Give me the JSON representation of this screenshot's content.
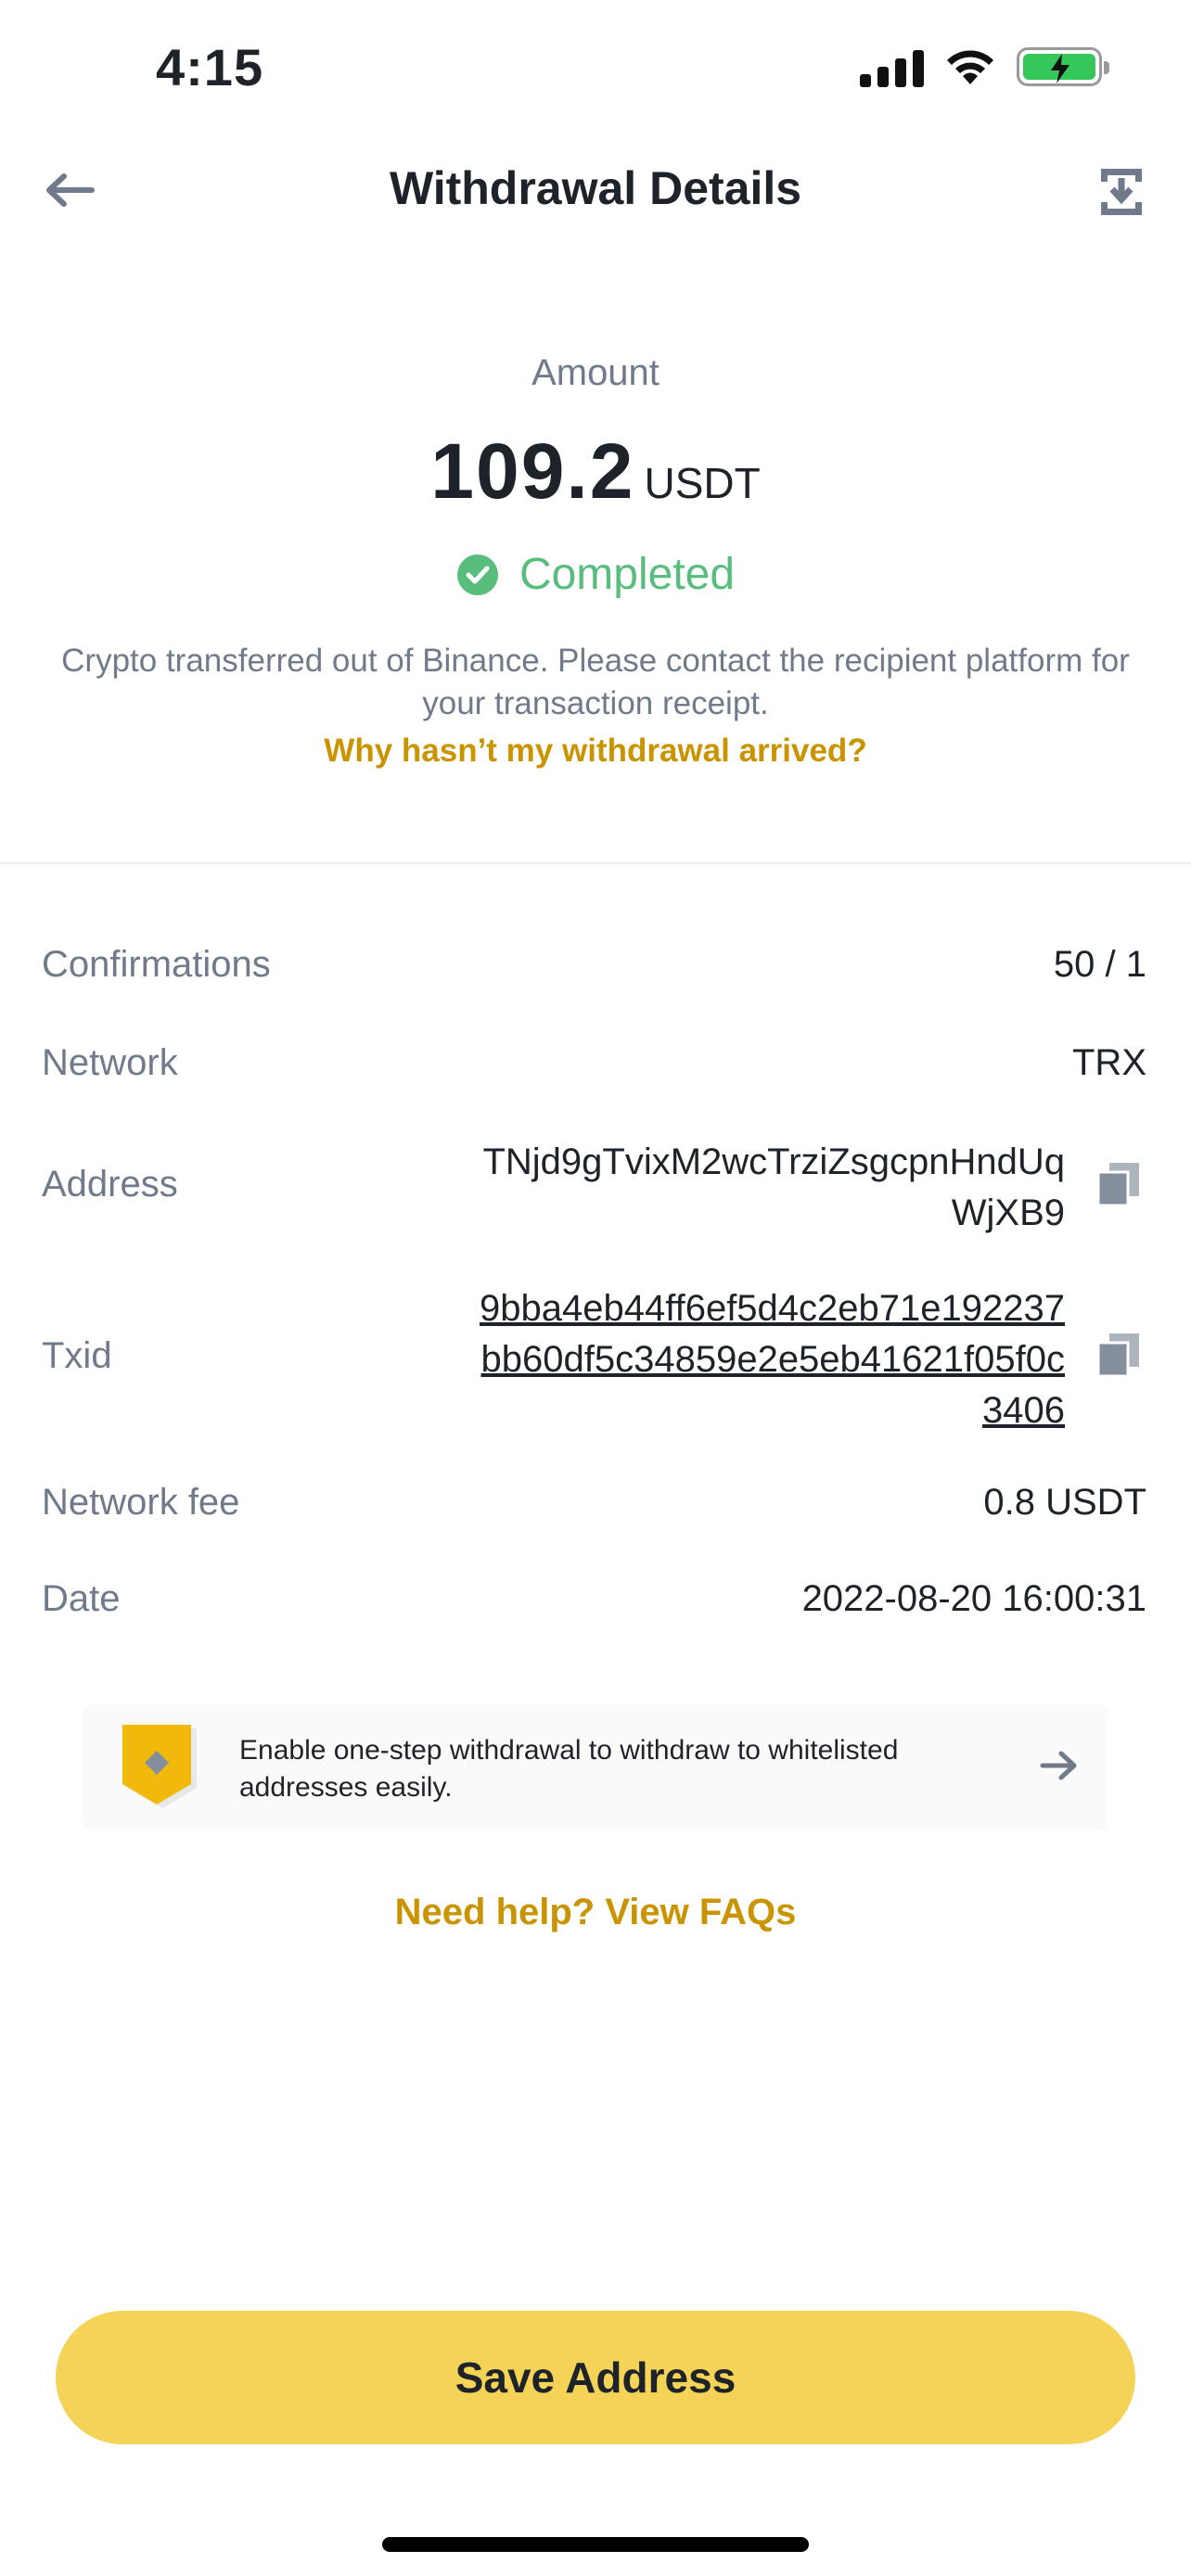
{
  "status_bar": {
    "time": "4:15"
  },
  "header": {
    "title": "Withdrawal Details"
  },
  "summary": {
    "amount_label": "Amount",
    "amount_value": "109.2",
    "amount_unit": "USDT",
    "status": "Completed",
    "status_color": "#58bd7d",
    "info": "Crypto transferred out of Binance. Please contact the recipient platform for your transaction receipt.",
    "help_link": "Why hasn’t my withdrawal arrived?"
  },
  "details": {
    "confirmations": {
      "label": "Confirmations",
      "value": "50 / 1"
    },
    "network": {
      "label": "Network",
      "value": "TRX"
    },
    "address": {
      "label": "Address",
      "line1": "TNjd9gTvixM2wcTrziZsgcpnHndUq",
      "line2": "WjXB9"
    },
    "txid": {
      "label": "Txid",
      "line1": "9bba4eb44ff6ef5d4c2eb71e192237",
      "line2": "bb60df5c34859e2e5eb41621f05f0c",
      "line3": "3406"
    },
    "network_fee": {
      "label": "Network fee",
      "value": "0.8 USDT"
    },
    "date": {
      "label": "Date",
      "value": "2022-08-20 16:00:31"
    }
  },
  "banner": {
    "line1": "Enable one-step withdrawal to withdraw to whitelisted",
    "line2": "addresses easily."
  },
  "faq_link": "Need help? View FAQs",
  "save_button": "Save Address",
  "colors": {
    "accent": "#c99400",
    "button": "#f4d357",
    "success": "#58bd7d",
    "muted": "#707a8a"
  },
  "icons": [
    "back-arrow-icon",
    "download-icon",
    "check-circle-icon",
    "copy-icon",
    "shield-icon",
    "arrow-right-icon"
  ]
}
